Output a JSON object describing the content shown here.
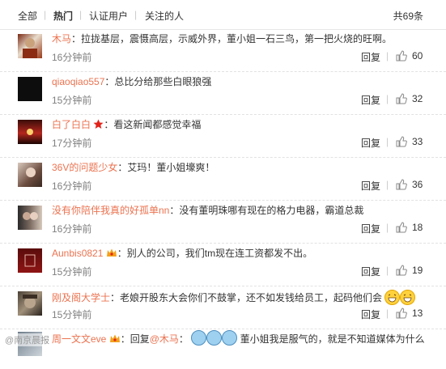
{
  "tabs": {
    "all": "全部",
    "hot": "热门",
    "verified": "认证用户",
    "following": "关注的人",
    "separator": "|"
  },
  "total": "共69条",
  "ui": {
    "reply": "回复",
    "divider": "|"
  },
  "accent_color": "#eb7350",
  "comments": [
    {
      "user": "木马",
      "text": "拉拢基层，震慑高层，示威外界，董小姐一石三鸟，第一把火烧的旺啊。",
      "time": "16分钟前",
      "likes": "60"
    },
    {
      "user": "qiaoqiao557",
      "text": "总比分给那些白眼狼强",
      "time": "15分钟前",
      "likes": "32"
    },
    {
      "user": "白了白白",
      "text": "看这新闻都感觉幸福",
      "time": "17分钟前",
      "likes": "33"
    },
    {
      "user": "36V的问题少女",
      "text": "艾玛！董小姐壕爽！",
      "time": "16分钟前",
      "likes": "36"
    },
    {
      "user": "没有你陪伴我真的好孤单nn",
      "text": "没有董明珠哪有现在的格力电器，霸道总裁",
      "time": "16分钟前",
      "likes": "18"
    },
    {
      "user": "Aunbis0821",
      "text": "别人的公司，我们tm现在连工资都发不出。",
      "time": "15分钟前",
      "likes": "19"
    },
    {
      "user": "刚及阁大学士",
      "text": "老娘开股东大会你们不鼓掌，还不如发钱给员工，起码他们会",
      "time": "15分钟前",
      "likes": "13"
    },
    {
      "user": "周一文文eve",
      "text_prefix": "回复",
      "mention": "@木马",
      "text": "董小姐我是服气的，就是不知道媒体为什么",
      "time": "",
      "likes": ""
    }
  ],
  "watermark": "@南京晨报"
}
